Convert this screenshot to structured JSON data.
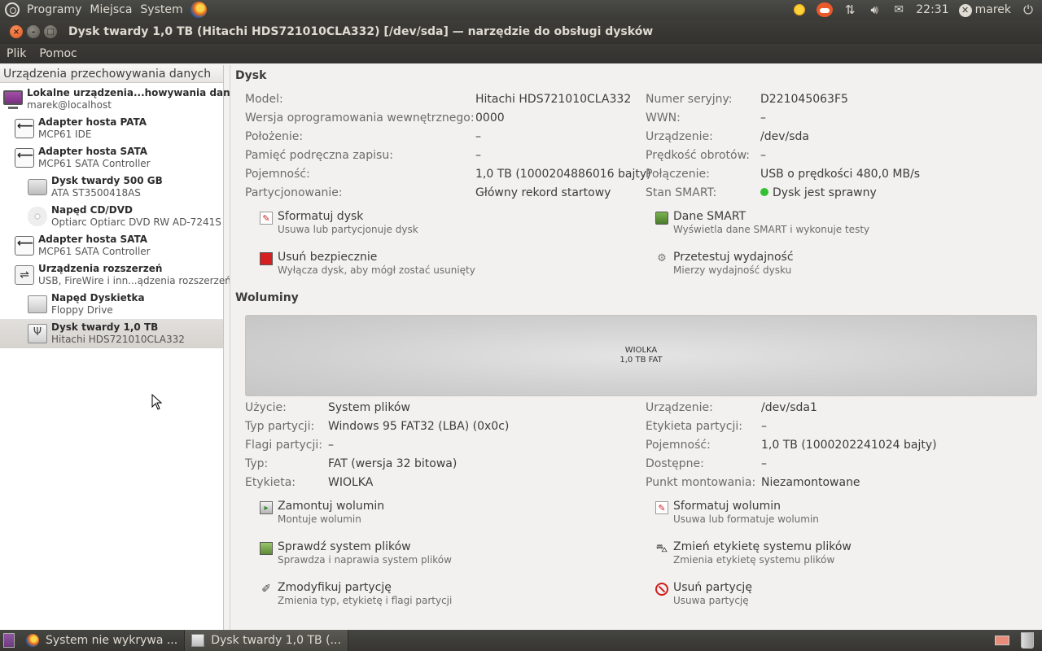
{
  "top_panel": {
    "menus": [
      "Programy",
      "Miejsca",
      "System"
    ],
    "clock": "22:31",
    "user": "marek"
  },
  "window": {
    "title": "Dysk twardy 1,0 TB (Hitachi HDS721010CLA332) [/dev/sda] — narzędzie do obsługi dysków"
  },
  "menubar": [
    "Plik",
    "Pomoc"
  ],
  "sidebar": {
    "header": "Urządzenia przechowywania danych",
    "items": [
      {
        "name": "Lokalne urządzenia...howywania danych",
        "desc": "marek@localhost",
        "icon": "computer-icon"
      },
      {
        "name": "Adapter hosta PATA",
        "desc": "MCP61 IDE",
        "icon": "adapter-icon"
      },
      {
        "name": "Adapter hosta SATA",
        "desc": "MCP61 SATA Controller",
        "icon": "adapter-icon"
      },
      {
        "name": "Dysk twardy 500 GB",
        "desc": "ATA ST3500418AS",
        "icon": "hard-disk-icon"
      },
      {
        "name": "Napęd CD/DVD",
        "desc": "Optiarc Optiarc DVD RW AD-7241S",
        "icon": "optical-drive-icon"
      },
      {
        "name": "Adapter hosta SATA",
        "desc": "MCP61 SATA Controller",
        "icon": "adapter-icon"
      },
      {
        "name": "Urządzenia rozszerzeń",
        "desc": "USB, FireWire i inn...ądzenia rozszerzeń",
        "icon": "usb-icon"
      },
      {
        "name": "Napęd Dyskietka",
        "desc": "Floppy Drive",
        "icon": "floppy-icon"
      },
      {
        "name": "Dysk twardy 1,0 TB",
        "desc": "Hitachi HDS721010CLA332",
        "icon": "usb-disk-icon"
      }
    ]
  },
  "disk": {
    "section_title": "Dysk",
    "left": [
      {
        "label": "Model:",
        "value": "Hitachi HDS721010CLA332"
      },
      {
        "label": "Wersja oprogramowania wewnętrznego:",
        "value": "0000"
      },
      {
        "label": "Położenie:",
        "value": "–"
      },
      {
        "label": "Pamięć podręczna zapisu:",
        "value": "–"
      },
      {
        "label": "Pojemność:",
        "value": "1,0 TB (1000204886016 bajty)"
      },
      {
        "label": "Partycjonowanie:",
        "value": "Główny rekord startowy"
      }
    ],
    "right": [
      {
        "label": "Numer seryjny:",
        "value": "D221045063F5"
      },
      {
        "label": "WWN:",
        "value": "–"
      },
      {
        "label": "Urządzenie:",
        "value": "/dev/sda"
      },
      {
        "label": "Prędkość obrotów:",
        "value": "–"
      },
      {
        "label": "Połączenie:",
        "value": "USB o prędkości 480,0 MB/s"
      },
      {
        "label": "Stan SMART:",
        "value": "Dysk jest sprawny"
      }
    ],
    "actions": [
      {
        "title": "Sformatuj dysk",
        "desc": "Usuwa lub partycjonuje dysk"
      },
      {
        "title": "Dane SMART",
        "desc": "Wyświetla dane SMART i wykonuje testy"
      },
      {
        "title": "Usuń bezpiecznie",
        "desc": "Wyłącza dysk, aby mógł zostać usunięty"
      },
      {
        "title": "Przetestuj wydajność",
        "desc": "Mierzy wydajność dysku"
      }
    ]
  },
  "volumes": {
    "section_title": "Woluminy",
    "bar": {
      "label": "WIOLKA",
      "sub": "1,0 TB FAT"
    },
    "left": [
      {
        "label": "Użycie:",
        "value": "System plików"
      },
      {
        "label": "Typ partycji:",
        "value": "Windows 95 FAT32 (LBA) (0x0c)"
      },
      {
        "label": "Flagi partycji:",
        "value": "–"
      },
      {
        "label": "Typ:",
        "value": "FAT (wersja 32 bitowa)"
      },
      {
        "label": "Etykieta:",
        "value": "WIOLKA"
      }
    ],
    "right": [
      {
        "label": "Urządzenie:",
        "value": "/dev/sda1"
      },
      {
        "label": "Etykieta partycji:",
        "value": "–"
      },
      {
        "label": "Pojemność:",
        "value": "1,0 TB (1000202241024 bajty)"
      },
      {
        "label": "Dostępne:",
        "value": "–"
      },
      {
        "label": "Punkt montowania:",
        "value": "Niezamontowane"
      }
    ],
    "actions": [
      {
        "title": "Zamontuj wolumin",
        "desc": "Montuje wolumin"
      },
      {
        "title": "Sformatuj wolumin",
        "desc": "Usuwa lub formatuje wolumin"
      },
      {
        "title": "Sprawdź system plików",
        "desc": "Sprawdza i naprawia system plików"
      },
      {
        "title": "Zmień etykietę systemu plików",
        "desc": "Zmienia etykietę systemu plików"
      },
      {
        "title": "Zmodyfikuj partycję",
        "desc": "Zmienia typ, etykietę i flagi partycji"
      },
      {
        "title": "Usuń partycję",
        "desc": "Usuwa partycję"
      }
    ]
  },
  "taskbar": {
    "items": [
      "System nie wykrywa ...",
      "Dysk twardy 1,0 TB (..."
    ]
  },
  "colors": {
    "smart_ok": "#33c033",
    "panel_bg": "#3c3b37",
    "close_button": "#e2541e"
  }
}
